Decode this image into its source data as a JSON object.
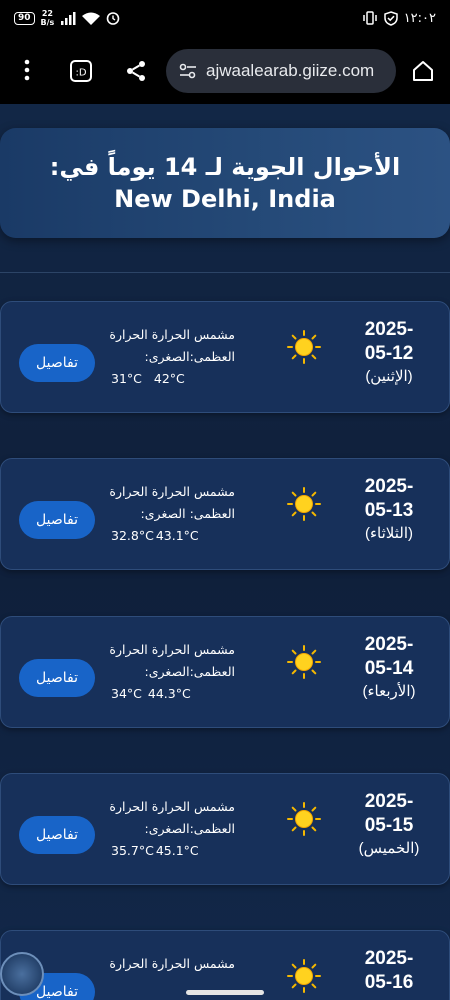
{
  "status_bar": {
    "battery": "90",
    "speed_top": "22",
    "speed_bottom": "B/s",
    "time": "١٢:٠٢"
  },
  "browser": {
    "url": "ajwaalearab.giize.com"
  },
  "page": {
    "title": "الأحوال الجوية لـ 14 يوماً في: New Delhi, India"
  },
  "days": [
    {
      "date_line1": "2025-",
      "date_line2": "05-12",
      "weekday": "(الإثنين)",
      "condition": "مشمس",
      "label_line1": "مشمس الحرارة الحرارة",
      "label_line2": "العظمى:الصغرى:",
      "max": "42°C",
      "min": "31°C",
      "button": "تفاصيل"
    },
    {
      "date_line1": "2025-",
      "date_line2": "05-13",
      "weekday": "(الثلاثاء)",
      "condition": "مشمس",
      "label_line1": "مشمس الحرارة الحرارة",
      "label_line2": "العظمى: الصغرى:",
      "max": "43.1°C",
      "min": "32.8°C",
      "button": "تفاصيل"
    },
    {
      "date_line1": "2025-",
      "date_line2": "05-14",
      "weekday": "(الأربعاء)",
      "condition": "مشمس",
      "label_line1": "مشمس الحرارة الحرارة",
      "label_line2": "العظمى:الصغرى:",
      "max": "44.3°C",
      "min": "34°C",
      "button": "تفاصيل"
    },
    {
      "date_line1": "2025-",
      "date_line2": "05-15",
      "weekday": "(الخميس)",
      "condition": "مشمس",
      "label_line1": "مشمس الحرارة الحرارة",
      "label_line2": "العظمى:الصغرى:",
      "max": "45.1°C",
      "min": "35.7°C",
      "button": "تفاصيل"
    },
    {
      "date_line1": "2025-",
      "date_line2": "05-16",
      "weekday": "",
      "condition": "مشمس",
      "label_line1": "مشمس الحرارة الحرارة",
      "label_line2": "",
      "max": "",
      "min": "",
      "button": "تفاصيل"
    }
  ],
  "colors": {
    "background": "#0f1d33",
    "card": "#17305a",
    "button": "#1864c8",
    "sun": "#f5b800"
  },
  "icons": [
    "more-vert-icon",
    "desktop-site-icon",
    "share-icon",
    "site-settings-icon",
    "home-icon",
    "sun-icon"
  ]
}
